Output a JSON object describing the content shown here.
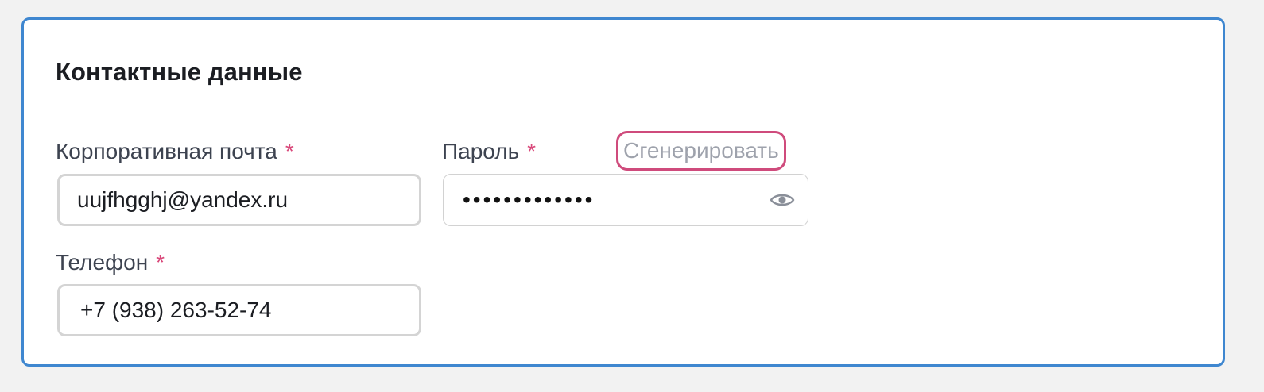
{
  "section": {
    "title": "Контактные данные"
  },
  "email": {
    "label": "Корпоративная почта",
    "required_mark": "*",
    "value": "uujfhgghj@yandex.ru"
  },
  "password": {
    "label": "Пароль",
    "required_mark": "*",
    "masked_value": "•••••••••••••",
    "generate_label": "Сгенерировать",
    "toggle_icon": "eye-icon"
  },
  "phone": {
    "label": "Телефон",
    "required_mark": "*",
    "value": "+7 (938) 263-52-74"
  },
  "colors": {
    "card_border": "#3f87d0",
    "required": "#d9487a",
    "generate_border": "#cf4b7c",
    "generate_text": "#9ea2ac"
  }
}
